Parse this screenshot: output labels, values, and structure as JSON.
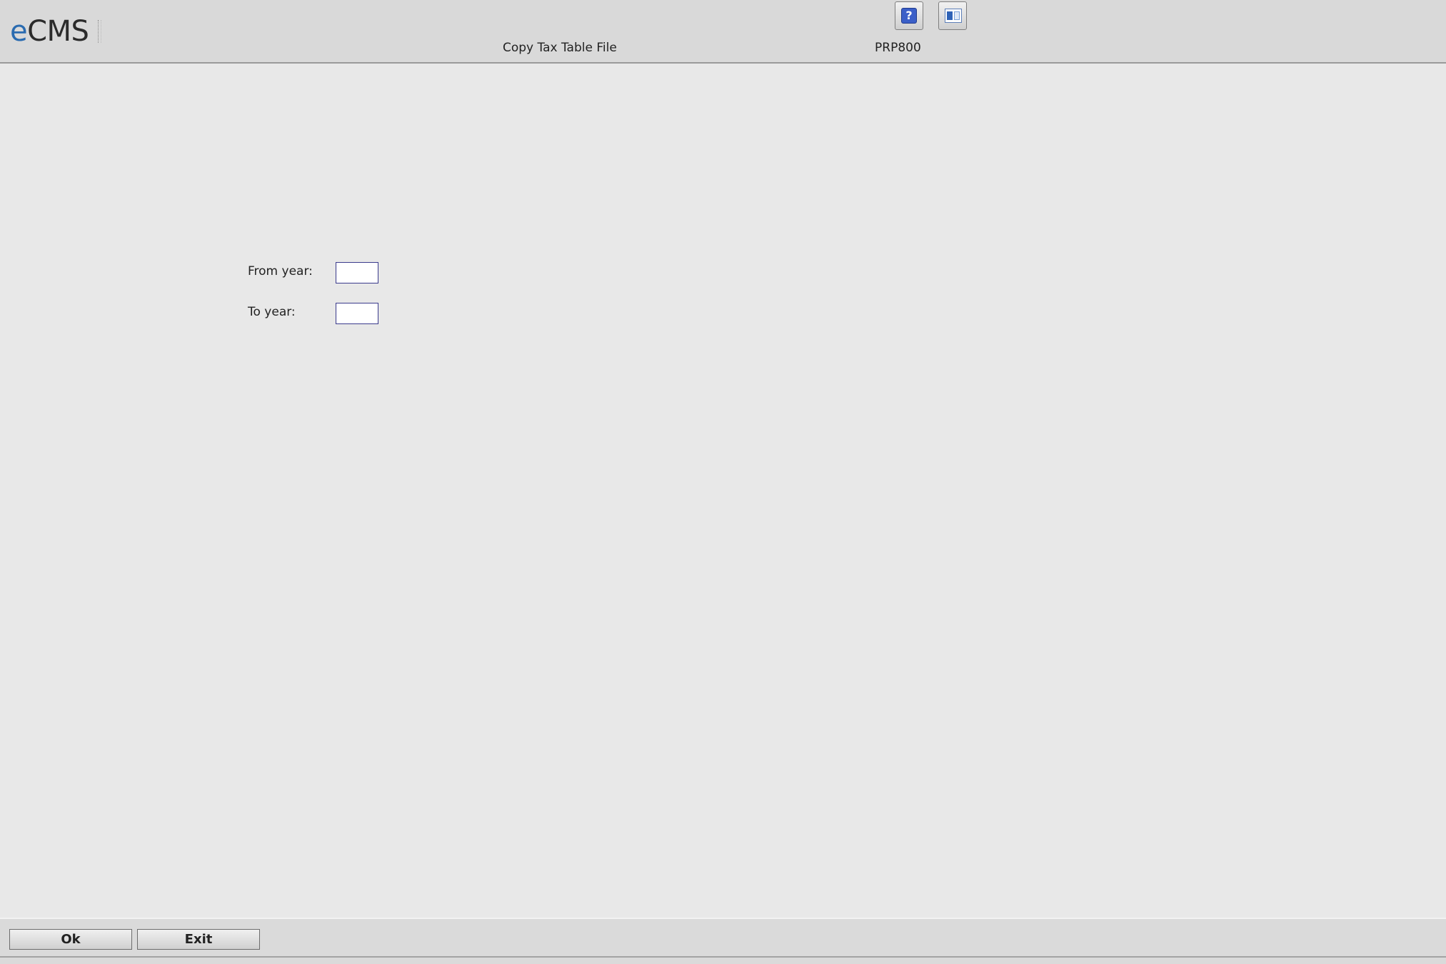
{
  "header": {
    "logo_prefix": "e",
    "logo_rest": "CMS",
    "screen_title": "Copy Tax Table File",
    "program_id": "PRP800",
    "help_glyph": "?",
    "icons": [
      "help-icon",
      "window-icon"
    ]
  },
  "form": {
    "from_year": {
      "label": "From year:",
      "value": ""
    },
    "to_year": {
      "label": "To year:",
      "value": ""
    }
  },
  "footer": {
    "ok_label": "Ok",
    "exit_label": "Exit"
  },
  "colors": {
    "background": "#e8e8e8",
    "header": "#d9d9d9",
    "logo_accent": "#2a6bb0",
    "input_border": "#3a3a8c",
    "help_icon": "#3b5fc8"
  }
}
